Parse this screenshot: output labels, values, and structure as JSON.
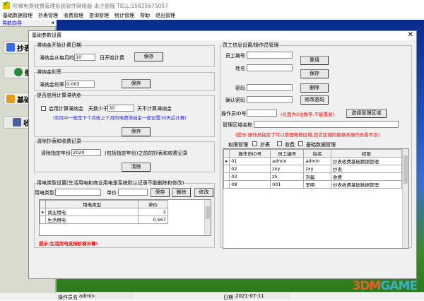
{
  "app": {
    "title": "阶梯电费收费管理系统软件网络版 未注册版  TELL:15825675057"
  },
  "menu": [
    "基础数据管理",
    "抄表管理",
    "收费管理",
    "查询管理",
    "统计管理",
    "帮助",
    "退出管理"
  ],
  "nav": {
    "header": "导航向导",
    "arrow": "◂",
    "buttons": [
      "抄表数",
      "缴费",
      "基础数",
      "收费"
    ]
  },
  "dialog": {
    "title": "基础参数设置",
    "close": "✕",
    "late_fee_date": {
      "legend": "滞纳金开始计费日期",
      "label": "滞纳金从每月的",
      "value": "10",
      "suffix": "日开始计费",
      "save": "保存"
    },
    "late_fee_rate": {
      "legend": "滞纳金利率",
      "label": "滞纳金利率",
      "value": "0.003",
      "save": "保存"
    },
    "enable_late_fee": {
      "legend": "是否启用计算滞纳金",
      "checkbox": "启用计算滞纳金",
      "days_label": "天数少于",
      "days_value": "30",
      "days_suffix": "天不计算滞纳金",
      "note": "(实际中一般是下个月收上个月的电费滞纳金一般设置30天后计算)",
      "save": "保存"
    },
    "clear_records": {
      "legend": "清除抄表和收费记录",
      "label": "清除指定年份",
      "value": "2020",
      "suffix": "(包括指定年份)之前的抄表和收费记录",
      "button": "清除"
    },
    "power_type": {
      "legend": "用电类型设置(生活用电和商业用电是系统默认记录不能删除和修改)",
      "type_label": "用电类型",
      "type_value": "",
      "price_label": "单价",
      "price_value": "",
      "save": "保存",
      "delete": "删除",
      "modify": "修改",
      "columns": [
        "用电类型",
        "单价"
      ],
      "rows": [
        {
          "type": "商业用电",
          "price": "2"
        },
        {
          "type": "生活用电",
          "price": "0.567"
        }
      ],
      "hint": "提示:生活用电支持阶梯计算!"
    },
    "staff": {
      "legend": "员工信息设置/操作员管理",
      "id_label": "员工编号",
      "name_label": "姓名",
      "pwd_label": "密码",
      "confirm_label": "确认密码",
      "reset": "重填",
      "save": "保存",
      "delete": "删除",
      "change_pwd": "修改密码",
      "op_id_label": "操作员ID号",
      "op_id_note": "(长度为2位数字,不能重复)",
      "select_area": "选择管理区域",
      "area_label": "管理区域名称",
      "area_note": "(提示:操作员指定了可以管理哪些区域,其它区域的数据本操作员看不到)",
      "perm_label": "权限管理",
      "perm_options": [
        "抄表",
        "收费",
        "基础数据管理"
      ],
      "columns": [
        "操作员ID号",
        "员工编号",
        "姓名",
        "权限"
      ],
      "rows": [
        {
          "op": "01",
          "id": "admin",
          "name": "admin",
          "perm": "抄表收费基础数据管理"
        },
        {
          "op": "02",
          "id": "zxy",
          "name": "zxy",
          "perm": "抄表"
        },
        {
          "op": "03",
          "id": "zh",
          "name": "刘磊",
          "perm": "收费"
        },
        {
          "op": "08",
          "id": "001",
          "name": "李明",
          "perm": "抄表收费基础数据管理"
        }
      ]
    }
  },
  "status": {
    "operator_label": "操作员名",
    "operator": "admin",
    "date_label": "日期",
    "date": "2021-07-11"
  },
  "watermark": {
    "a": "3DM",
    "b": "GAME"
  }
}
